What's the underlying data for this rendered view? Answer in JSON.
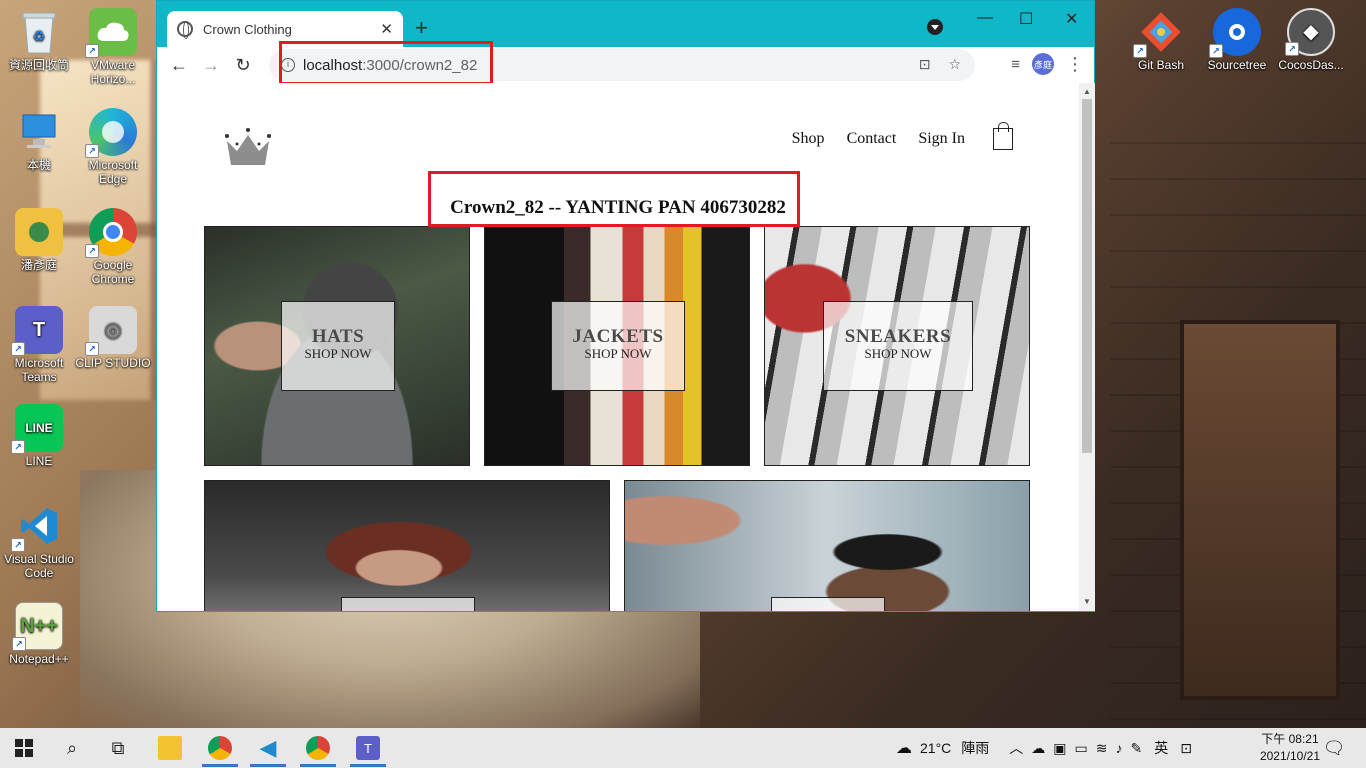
{
  "desktop": {
    "left_icons": [
      {
        "label": "資源回收筒",
        "icon": "recycle-bin-icon"
      },
      {
        "label": "VMware Horizo...",
        "icon": "vmware-icon"
      },
      {
        "label": "本機",
        "icon": "this-pc-icon"
      },
      {
        "label": "Microsoft Edge",
        "icon": "edge-icon"
      },
      {
        "label": "潘彥庭",
        "icon": "user-folder-icon"
      },
      {
        "label": "Google Chrome",
        "icon": "chrome-icon"
      },
      {
        "label": "Microsoft Teams",
        "icon": "teams-icon"
      },
      {
        "label": "CLIP STUDIO",
        "icon": "clip-studio-icon"
      },
      {
        "label": "LINE",
        "icon": "line-icon"
      },
      {
        "label": "Visual Studio Code",
        "icon": "vscode-icon"
      },
      {
        "label": "Notepad++",
        "icon": "notepadpp-icon"
      }
    ],
    "right_icons": [
      {
        "label": "Git Bash",
        "icon": "git-bash-icon"
      },
      {
        "label": "Sourcetree",
        "icon": "sourcetree-icon"
      },
      {
        "label": "CocosDas...",
        "icon": "cocos-icon"
      }
    ]
  },
  "browser": {
    "tab_title": "Crown Clothing",
    "url_host": "localhost",
    "url_path": ":3000/crown2_82",
    "profile_initial": "彥庭"
  },
  "site": {
    "nav": {
      "shop": "Shop",
      "contact": "Contact",
      "sign_in": "Sign In"
    },
    "heading": "Crown2_82 -- YANTING PAN 406730282",
    "categories": [
      {
        "title": "HATS",
        "subtitle": "SHOP NOW"
      },
      {
        "title": "JACKETS",
        "subtitle": "SHOP NOW"
      },
      {
        "title": "SNEAKERS",
        "subtitle": "SHOP NOW"
      }
    ]
  },
  "taskbar": {
    "weather": "21°C",
    "weather_desc": "陣雨",
    "ime": "英",
    "time": "下午 08:21",
    "date": "2021/10/21"
  },
  "colors": {
    "tabbar": "#0fb7c9",
    "highlight_box": "#e01b24",
    "taskbar": "#e8e8e8"
  }
}
